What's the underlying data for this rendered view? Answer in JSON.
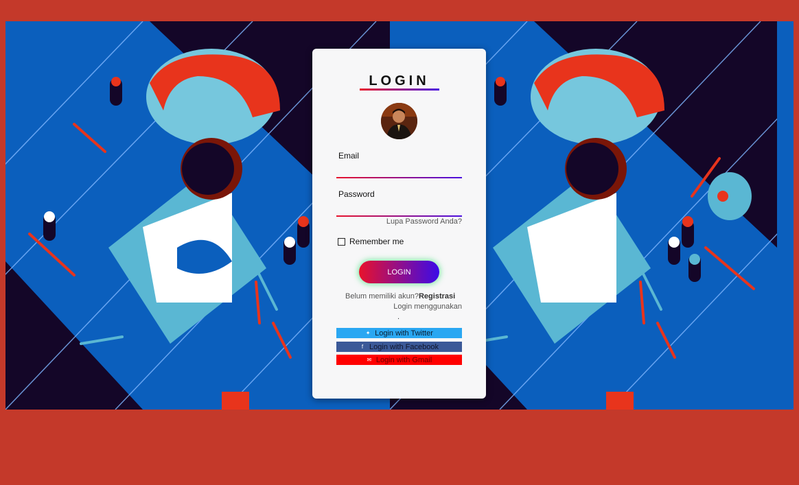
{
  "login": {
    "title": "LOGIN",
    "email_label": "Email",
    "email_value": "",
    "password_label": "Password",
    "password_value": "",
    "forgot_link": "Lupa Password Anda?",
    "remember_label": "Remember me",
    "submit_label": "LOGIN",
    "no_account_text": "Belum memiliki akun?",
    "register_link": "Registrasi",
    "login_using_text": "Login menggunakan",
    "separator": ".",
    "social": [
      {
        "label": "Login with Twitter",
        "icon": "twitter-icon",
        "color": "#2aa7f2"
      },
      {
        "label": "Login with Facebook",
        "icon": "facebook-icon",
        "color": "#3b5998"
      },
      {
        "label": "Login with Gmail",
        "icon": "mail-icon",
        "color": "#ff0000"
      }
    ]
  },
  "colors": {
    "page_background": "#c4392a",
    "gradient_start": "#e8122c",
    "gradient_end": "#4a0fe0"
  }
}
